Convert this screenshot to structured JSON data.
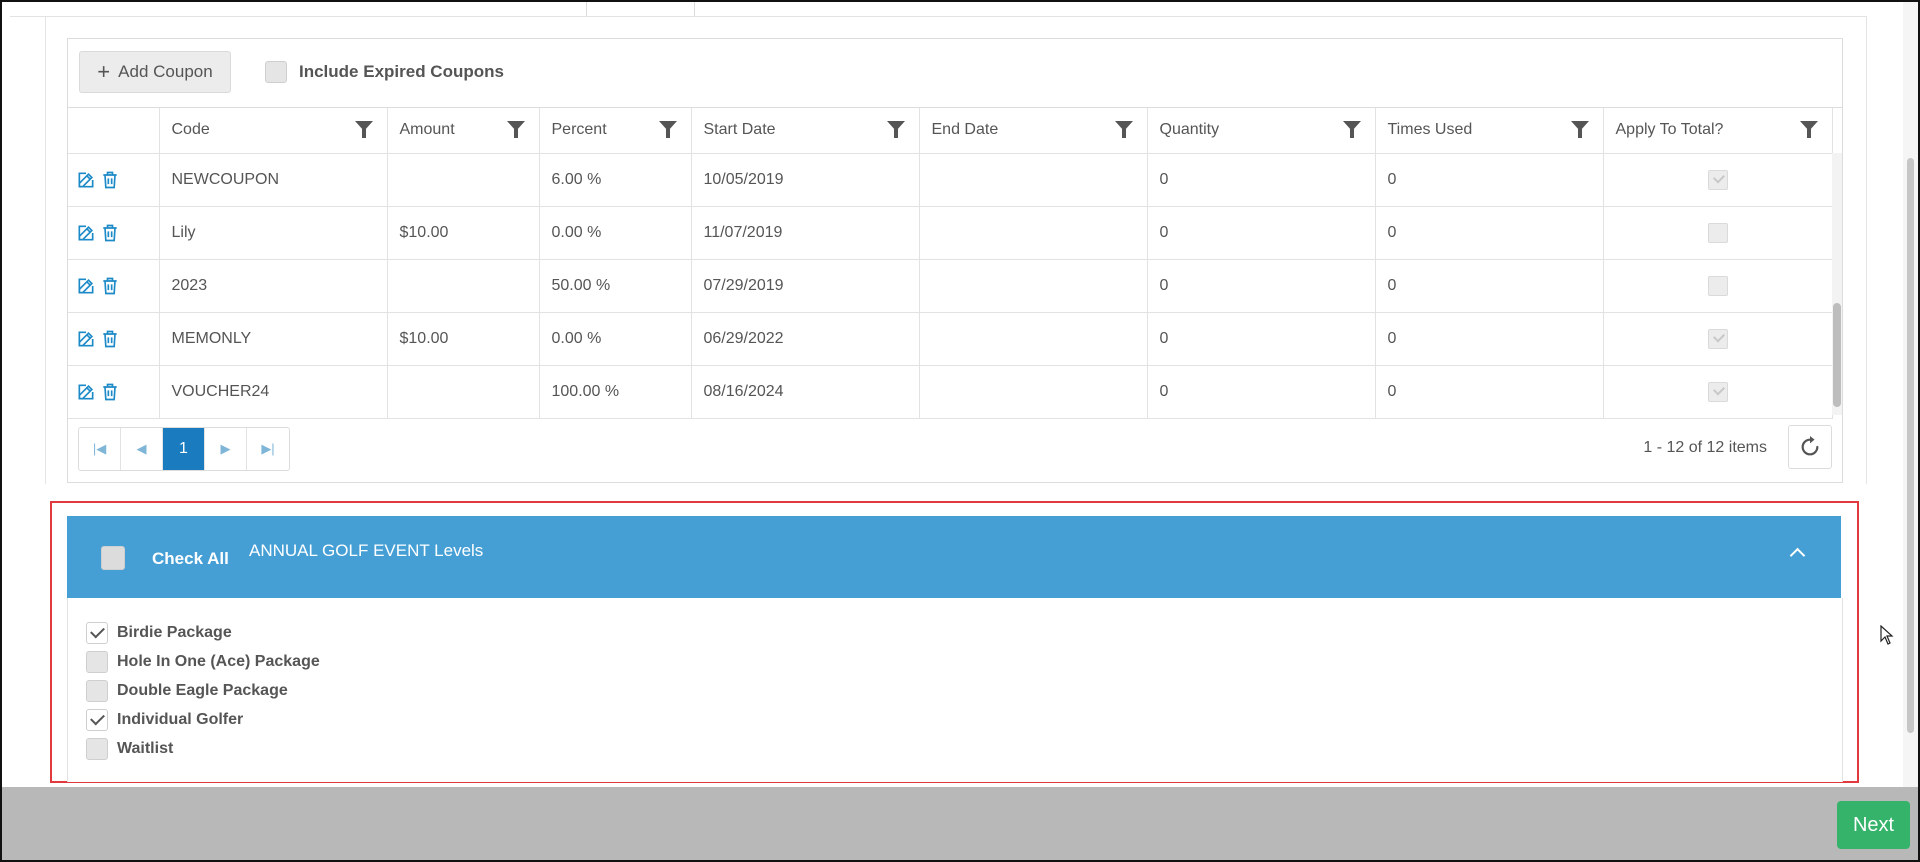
{
  "toolbar": {
    "add_coupon_label": "Add Coupon",
    "include_expired_label": "Include Expired Coupons"
  },
  "columns": [
    "Code",
    "Amount",
    "Percent",
    "Start Date",
    "End Date",
    "Quantity",
    "Times Used",
    "Apply To Total?"
  ],
  "rows": [
    {
      "code": "NEWCOUPON",
      "amount": "",
      "percent": "6.00 %",
      "start": "10/05/2019",
      "end": "",
      "quantity": "0",
      "used": "0",
      "apply": true
    },
    {
      "code": "Lily",
      "amount": "$10.00",
      "percent": "0.00 %",
      "start": "11/07/2019",
      "end": "",
      "quantity": "0",
      "used": "0",
      "apply": false
    },
    {
      "code": "2023",
      "amount": "",
      "percent": "50.00 %",
      "start": "07/29/2019",
      "end": "",
      "quantity": "0",
      "used": "0",
      "apply": false
    },
    {
      "code": "MEMONLY",
      "amount": "$10.00",
      "percent": "0.00 %",
      "start": "06/29/2022",
      "end": "",
      "quantity": "0",
      "used": "0",
      "apply": true
    },
    {
      "code": "VOUCHER24",
      "amount": "",
      "percent": "100.00 %",
      "start": "08/16/2024",
      "end": "",
      "quantity": "0",
      "used": "0",
      "apply": true
    }
  ],
  "pager": {
    "current_page": "1",
    "summary": "1 - 12 of 12 items"
  },
  "levels": {
    "check_all_label": "Check All",
    "title": "ANNUAL GOLF EVENT Levels",
    "items": [
      {
        "label": "Birdie Package",
        "checked": true
      },
      {
        "label": "Hole In One (Ace) Package",
        "checked": false
      },
      {
        "label": "Double Eagle Package",
        "checked": false
      },
      {
        "label": "Individual Golfer",
        "checked": true
      },
      {
        "label": "Waitlist",
        "checked": false
      }
    ]
  },
  "footer": {
    "next_label": "Next"
  },
  "colors": {
    "accent_blue": "#459fd5",
    "pager_active": "#1a7bbf",
    "next_green": "#36b36a",
    "highlight_red": "#e0393e",
    "icon_blue": "#1d8ac8"
  },
  "icons": {
    "edit": "edit-icon",
    "delete": "trash-icon",
    "filter": "filter-icon",
    "refresh": "refresh-icon",
    "collapse": "chevron-up-icon"
  }
}
